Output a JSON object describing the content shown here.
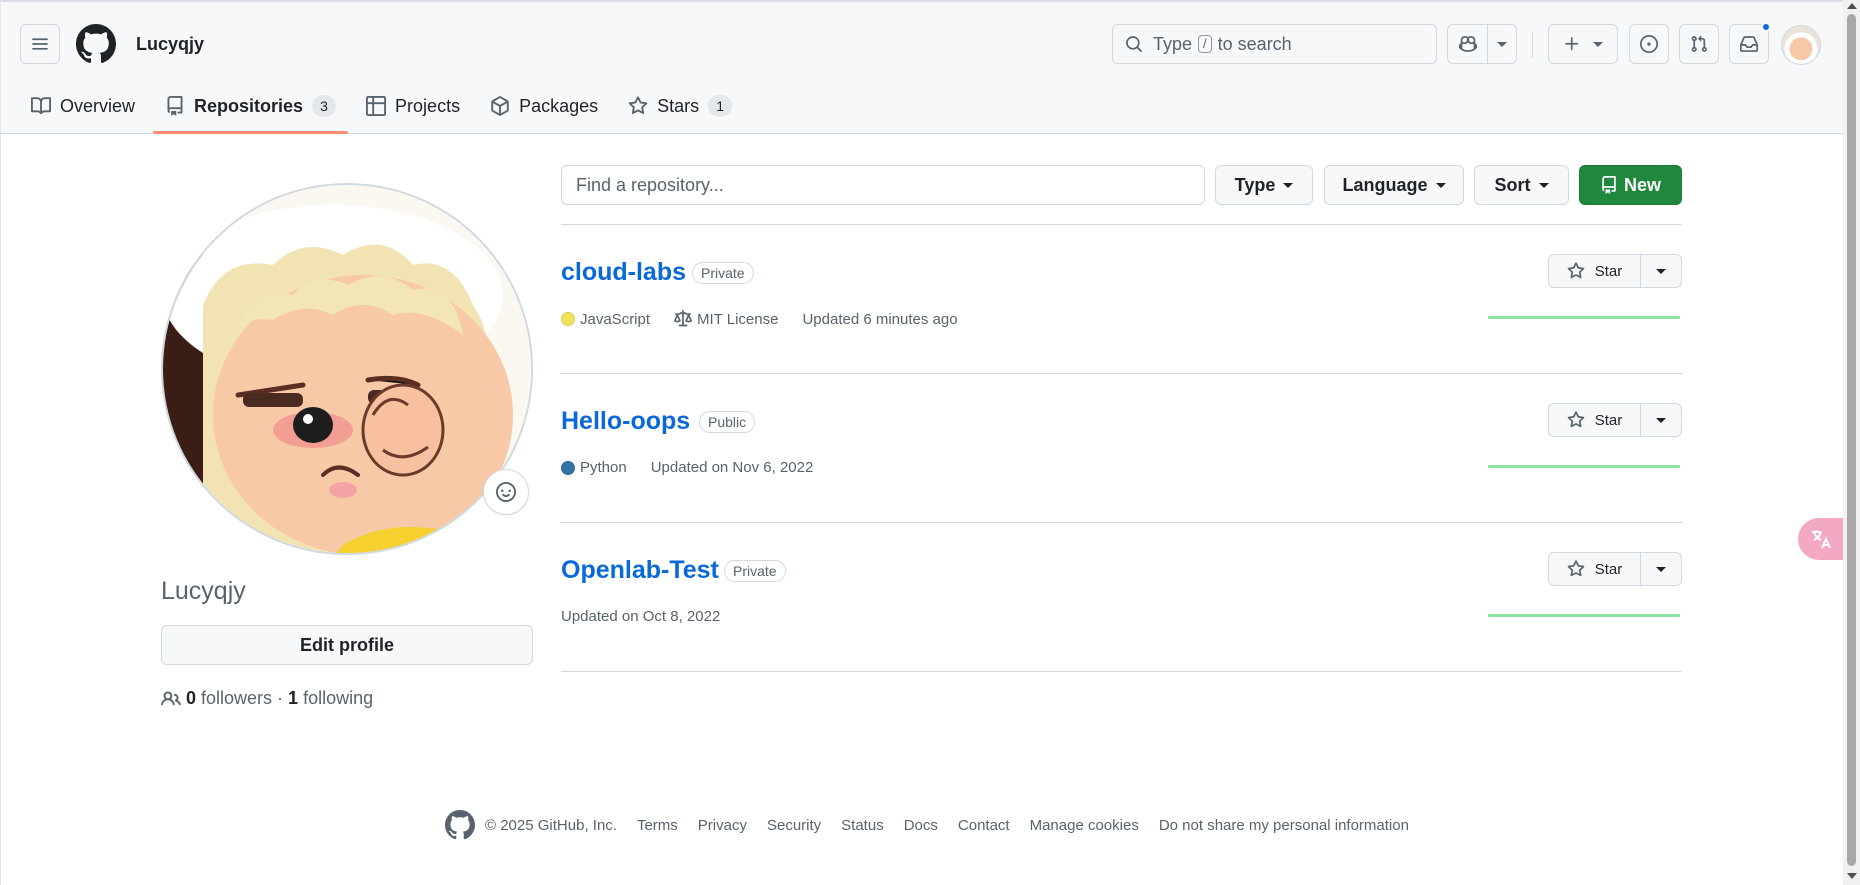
{
  "header": {
    "username": "Lucyqjy",
    "search_text_before": "Type",
    "search_key": "/",
    "search_text_after": "to search"
  },
  "tabs": [
    {
      "label": "Overview"
    },
    {
      "label": "Repositories",
      "count": "3"
    },
    {
      "label": "Projects"
    },
    {
      "label": "Packages"
    },
    {
      "label": "Stars",
      "count": "1"
    }
  ],
  "profile": {
    "login": "Lucyqjy",
    "edit_label": "Edit profile",
    "followers_count": "0",
    "followers_label": "followers",
    "separator": "·",
    "following_count": "1",
    "following_label": "following"
  },
  "filters": {
    "find_placeholder": "Find a repository...",
    "type_label": "Type",
    "language_label": "Language",
    "sort_label": "Sort",
    "new_label": "New"
  },
  "repos": [
    {
      "name": "cloud-labs",
      "visibility": "Private",
      "language": "JavaScript",
      "language_color": "#f1e05a",
      "license": "MIT License",
      "updated": "Updated 6 minutes ago",
      "star_label": "Star"
    },
    {
      "name": "Hello-oops",
      "visibility": "Public",
      "language": "Python",
      "language_color": "#3572A5",
      "updated": "Updated on Nov 6, 2022",
      "star_label": "Star"
    },
    {
      "name": "Openlab-Test",
      "visibility": "Private",
      "updated": "Updated on Oct 8, 2022",
      "star_label": "Star"
    }
  ],
  "footer": {
    "copyright": "© 2025 GitHub, Inc.",
    "links": [
      "Terms",
      "Privacy",
      "Security",
      "Status",
      "Docs",
      "Contact",
      "Manage cookies",
      "Do not share my personal information"
    ]
  },
  "colors": {
    "accent": "#0969da",
    "new_button": "#1f883d",
    "tab_underline": "#fd8c73",
    "sparkline": "#8ee2a0"
  }
}
